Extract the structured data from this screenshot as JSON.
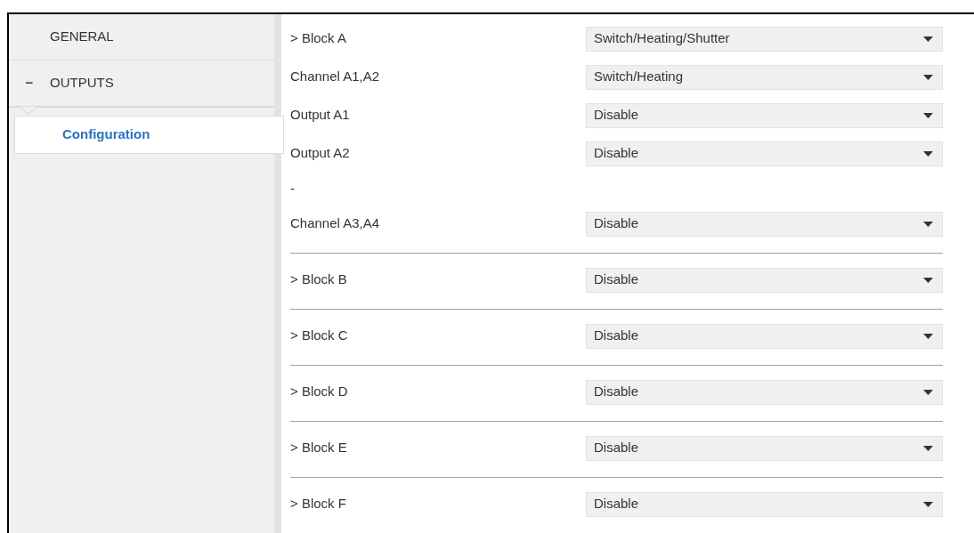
{
  "sidebar": {
    "items": [
      {
        "label": "GENERAL",
        "kind": "section",
        "selected": false
      },
      {
        "label": "OUTPUTS",
        "kind": "section",
        "expanded": true,
        "selected": false,
        "toggle": "−"
      },
      {
        "label": "Configuration",
        "kind": "page",
        "selected": true
      }
    ]
  },
  "rows": [
    {
      "kind": "select",
      "label": "> Block A",
      "value": "Switch/Heating/Shutter",
      "rule_above": false
    },
    {
      "kind": "select",
      "label": "Channel A1,A2",
      "value": "Switch/Heating",
      "rule_above": false
    },
    {
      "kind": "select",
      "label": "Output A1",
      "value": "Disable",
      "rule_above": false
    },
    {
      "kind": "select",
      "label": "Output A2",
      "value": "Disable",
      "rule_above": false
    },
    {
      "kind": "note",
      "label": "-",
      "rule_above": false
    },
    {
      "kind": "select",
      "label": "Channel A3,A4",
      "value": "Disable",
      "rule_above": false
    },
    {
      "kind": "select",
      "label": "> Block B",
      "value": "Disable",
      "rule_above": true
    },
    {
      "kind": "select",
      "label": "> Block C",
      "value": "Disable",
      "rule_above": true
    },
    {
      "kind": "select",
      "label": "> Block D",
      "value": "Disable",
      "rule_above": true
    },
    {
      "kind": "select",
      "label": "> Block E",
      "value": "Disable",
      "rule_above": true
    },
    {
      "kind": "select",
      "label": "> Block F",
      "value": "Disable",
      "rule_above": true
    }
  ]
}
